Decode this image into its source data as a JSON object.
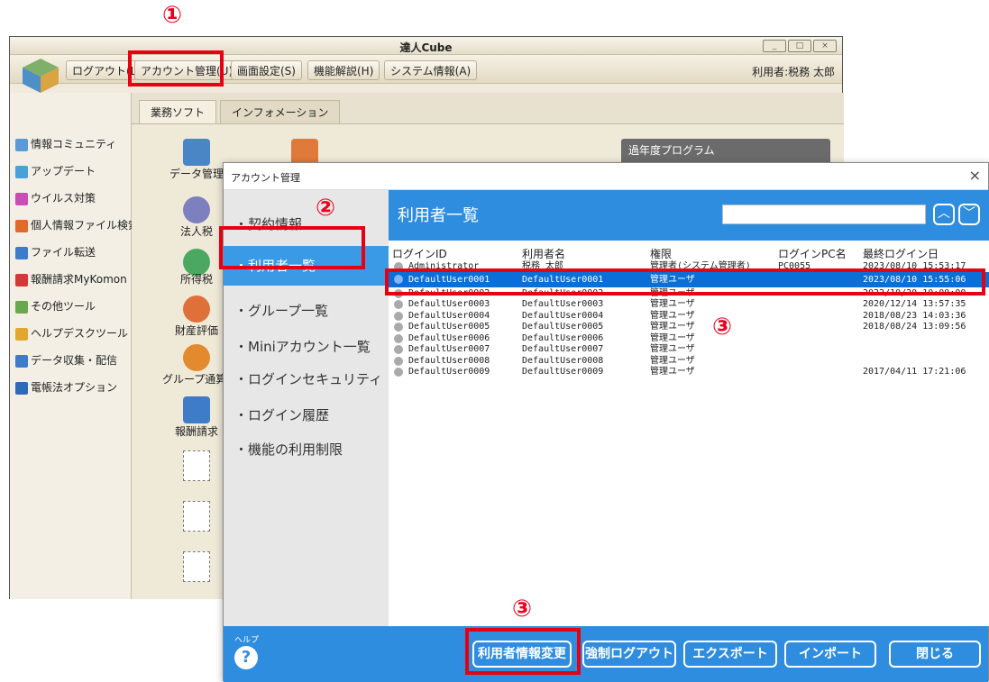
{
  "markers": {
    "m1": "①",
    "m2": "②",
    "m3a": "③",
    "m3b": "③"
  },
  "window": {
    "title": "達人Cube",
    "user": "利用者:税務 太郎",
    "menu": [
      "ログアウト(L)",
      "アカウント管理(U)",
      "画面設定(S)",
      "機能解説(H)",
      "システム情報(A)"
    ]
  },
  "sidebar": {
    "items": [
      "情報コミュニティ",
      "アップデート",
      "ウイルス対策",
      "個人情報ファイル検索",
      "ファイル転送",
      "報酬請求MyKomon",
      "その他ツール",
      "ヘルプデスクツール",
      "データ収集・配信",
      "電帳法オプション"
    ]
  },
  "tabs": [
    "業務ソフト",
    "インフォメーション"
  ],
  "apps": [
    "データ管理",
    "法人税",
    "所得税",
    "財産評価",
    "グループ通算(",
    "報酬請求"
  ],
  "past_program": "過年度プログラム",
  "dialog": {
    "title": "アカウント管理",
    "close": "×",
    "nav": [
      "・契約情報",
      "・利用者一覧",
      "・グループ一覧",
      "・Miniアカウント一覧",
      "・ログインセキュリティ",
      "・ログイン履歴",
      "・機能の利用制限"
    ],
    "header": "利用者一覧",
    "columns": [
      "ログインID",
      "利用者名",
      "権限",
      "ログインPC名",
      "最終ログイン日"
    ],
    "rows": [
      [
        "Administrator",
        "税務 太郎",
        "管理者(システム管理者)",
        "PC0055",
        "2023/08/10 15:53:17"
      ],
      [
        "DefaultUser0001",
        "DefaultUser0001",
        "管理ユーザ",
        "",
        "2023/08/10 15:55:06"
      ],
      [
        "DefaultUser0002",
        "DefaultUser0002",
        "管理ユーザ",
        "",
        "2022/10/20 10:00:00"
      ],
      [
        "DefaultUser0003",
        "DefaultUser0003",
        "管理ユーザ",
        "",
        "2020/12/14 13:57:35"
      ],
      [
        "DefaultUser0004",
        "DefaultUser0004",
        "管理ユーザ",
        "",
        "2018/08/23 14:03:36"
      ],
      [
        "DefaultUser0005",
        "DefaultUser0005",
        "管理ユーザ",
        "",
        "2018/08/24 13:09:56"
      ],
      [
        "DefaultUser0006",
        "DefaultUser0006",
        "管理ユーザ",
        "",
        ""
      ],
      [
        "DefaultUser0007",
        "DefaultUser0007",
        "管理ユーザ",
        "",
        ""
      ],
      [
        "DefaultUser0008",
        "DefaultUser0008",
        "管理ユーザ",
        "",
        ""
      ],
      [
        "DefaultUser0009",
        "DefaultUser0009",
        "管理ユーザ",
        "",
        "2017/04/11 17:21:06"
      ]
    ],
    "footer": {
      "help": "ヘルプ",
      "buttons": [
        "利用者情報変更",
        "強制ログアウト",
        "エクスポート",
        "インポート",
        "閉じる"
      ]
    }
  }
}
